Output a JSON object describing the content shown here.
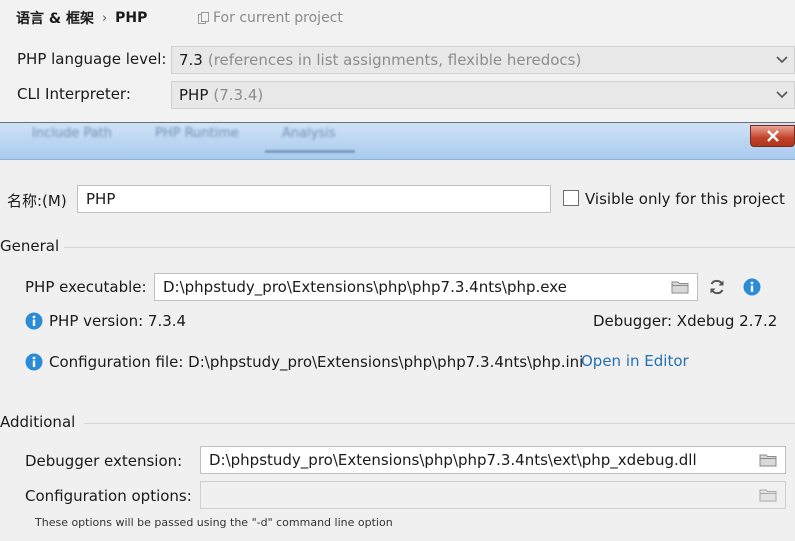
{
  "breadcrumb": {
    "parent": "语言 & 框架",
    "separator": "›",
    "current": "PHP"
  },
  "scope_label": "For current project",
  "language_level": {
    "label": "PHP language level:",
    "value": "7.3",
    "hint": "(references in list assignments, flexible heredocs)"
  },
  "cli_interpreter": {
    "label": "CLI Interpreter:",
    "value": "PHP",
    "hint": "(7.3.4)"
  },
  "dialog": {
    "tabs": [
      "Include Path",
      "PHP Runtime",
      "Analysis"
    ],
    "close_glyph": "✕",
    "name_label": "名称:(M)",
    "name_value": "PHP",
    "visible_only_label": "Visible only for this project",
    "general": {
      "title": "General",
      "executable_label": "PHP executable:",
      "executable_value": "D:\\phpstudy_pro\\Extensions\\php\\php7.3.4nts\\php.exe",
      "php_version": "PHP version: 7.3.4",
      "debugger": "Debugger: Xdebug 2.7.2",
      "config_file": "Configuration file: D:\\phpstudy_pro\\Extensions\\php\\php7.3.4nts\\php.ini",
      "open_in_editor": "Open in Editor"
    },
    "additional": {
      "title": "Additional",
      "debugger_ext_label": "Debugger extension:",
      "debugger_ext_value": "D:\\phpstudy_pro\\Extensions\\php\\php7.3.4nts\\ext\\php_xdebug.dll",
      "config_options_label": "Configuration options:",
      "config_options_value": "",
      "note": "These options will be passed using the \"-d\" command line option"
    }
  },
  "colors": {
    "titlebar": "#a9cbee",
    "close_button": "#c2412a",
    "link": "#2470b3",
    "info_icon": "#2a8bd6"
  },
  "icons": [
    "copy-icon",
    "chevron-down-icon",
    "close-icon",
    "folder-icon",
    "reload-icon",
    "info-icon"
  ]
}
